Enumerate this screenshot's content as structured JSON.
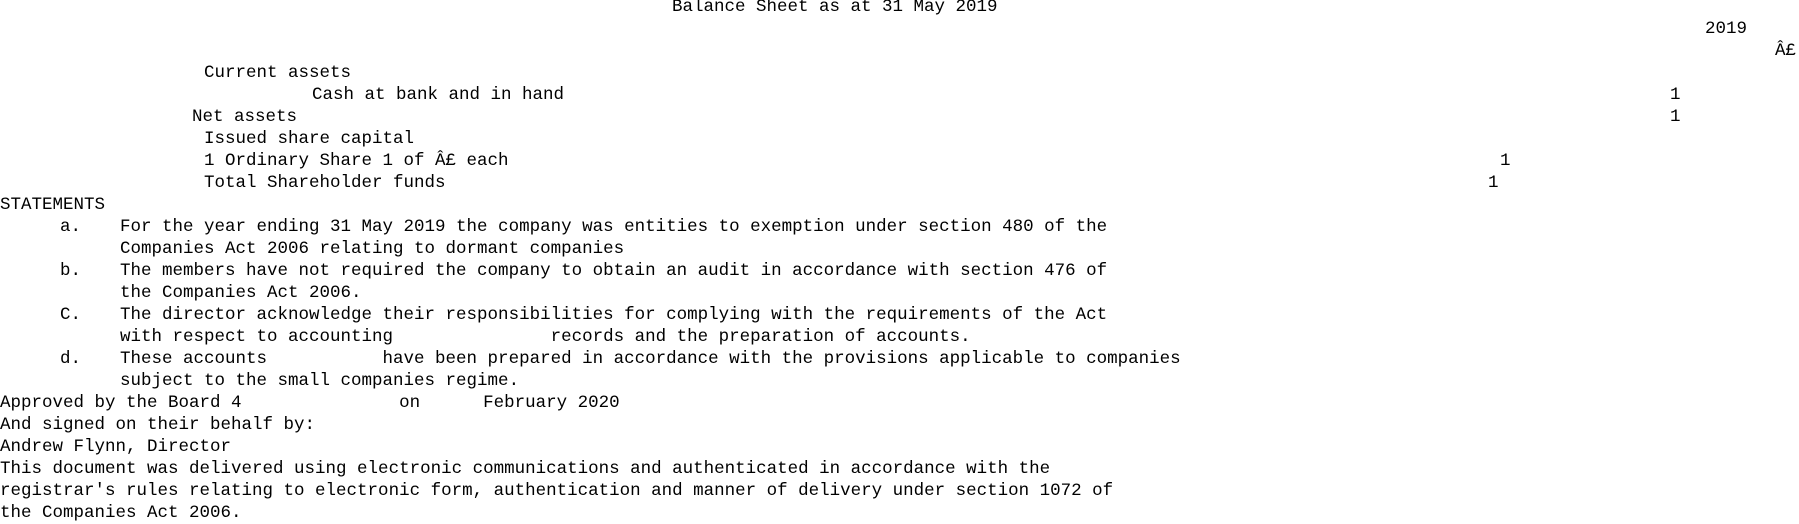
{
  "title": "Balance Sheet as at 31 May 2019",
  "header": {
    "year": "2019",
    "currency": "Â£"
  },
  "balance": {
    "current_assets_label": "Current assets",
    "cash_label": "Cash at bank and in hand",
    "cash_value": "1",
    "net_assets_label": "Net assets",
    "net_assets_value": "1",
    "issued_share_capital_label": "Issued share capital",
    "ordinary_share_label": "1 Ordinary Share 1 of Â£ each",
    "ordinary_share_value": "1",
    "total_funds_label": "Total Shareholder funds",
    "total_funds_value": "1"
  },
  "statements": {
    "heading": "STATEMENTS",
    "items": [
      {
        "marker": "a.",
        "lines": [
          "For the year ending 31 May 2019 the company was entities to exemption under section 480 of the",
          "Companies Act 2006 relating to dormant companies"
        ]
      },
      {
        "marker": "b.",
        "lines": [
          "The members have not required the company to obtain an audit in accordance with section 476 of",
          "the Companies Act 2006."
        ]
      },
      {
        "marker": "C.",
        "lines": [
          "The director acknowledge their responsibilities for complying with the requirements of the Act",
          "with respect to accounting               records and the preparation of accounts."
        ]
      },
      {
        "marker": "d.",
        "lines": [
          "These accounts           have been prepared in accordance with the provisions applicable to companies",
          "subject to the small companies regime."
        ]
      }
    ]
  },
  "approval": {
    "approved_line": "Approved by the Board 4               on      February 2020",
    "signed_line": "And signed on their behalf by:",
    "signatory": "Andrew Flynn, Director"
  },
  "footer": {
    "lines": [
      "This document was delivered using electronic communications and authenticated in accordance with the",
      "registrar's rules relating to electronic form, authentication and manner of delivery under section 1072 of",
      "the Companies Act 2006."
    ]
  }
}
